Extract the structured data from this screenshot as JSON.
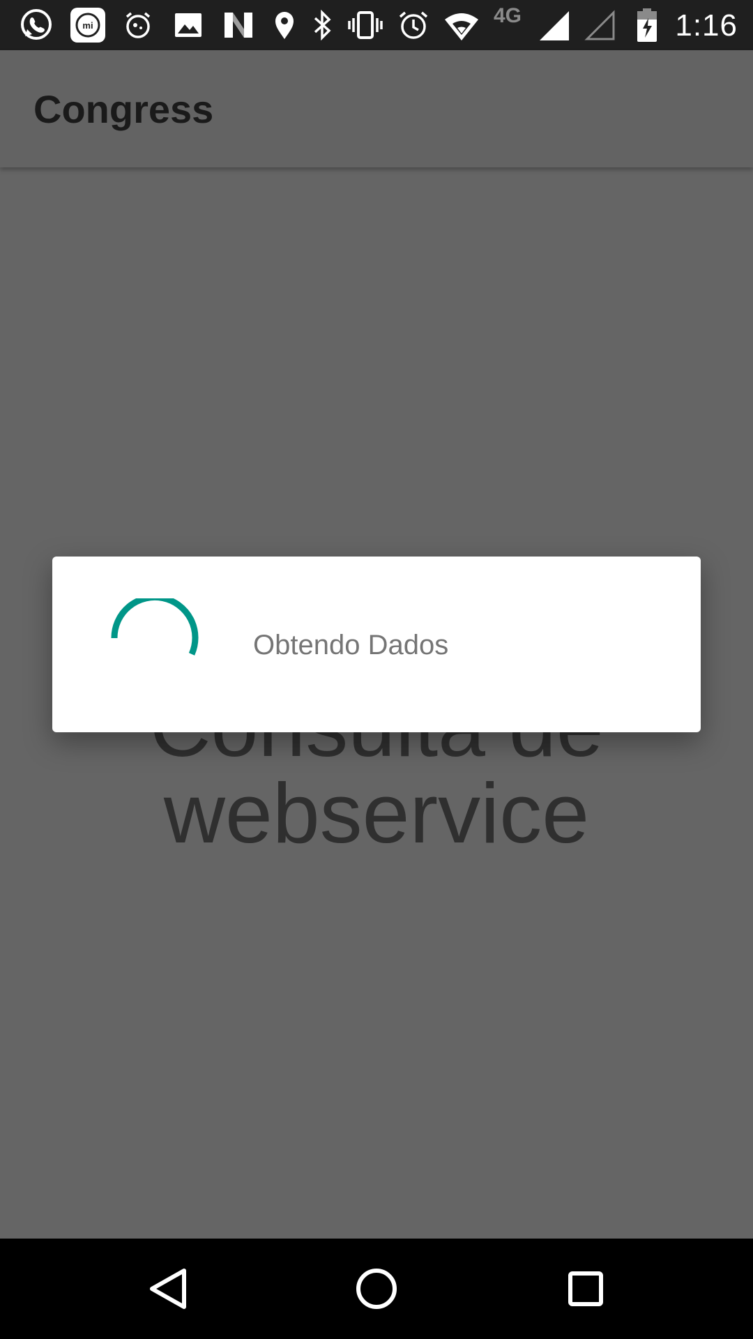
{
  "status_bar": {
    "time": "1:16",
    "network_label": "4G",
    "icons": [
      "whatsapp-icon",
      "mi-icon",
      "alarm-clock-icon",
      "image-icon",
      "n-icon",
      "location-icon",
      "bluetooth-icon",
      "vibrate-icon",
      "alarm-icon",
      "wifi-icon",
      "signal-icon",
      "signal-empty-icon",
      "battery-charging-icon"
    ]
  },
  "app_bar": {
    "title": "Congress"
  },
  "content": {
    "line1": "Consulta de",
    "line2": "webservice"
  },
  "dialog": {
    "message": "Obtendo Dados",
    "spinner_color": "#009688"
  },
  "nav_bar": {
    "buttons": [
      "back-icon",
      "home-icon",
      "recents-icon"
    ]
  }
}
